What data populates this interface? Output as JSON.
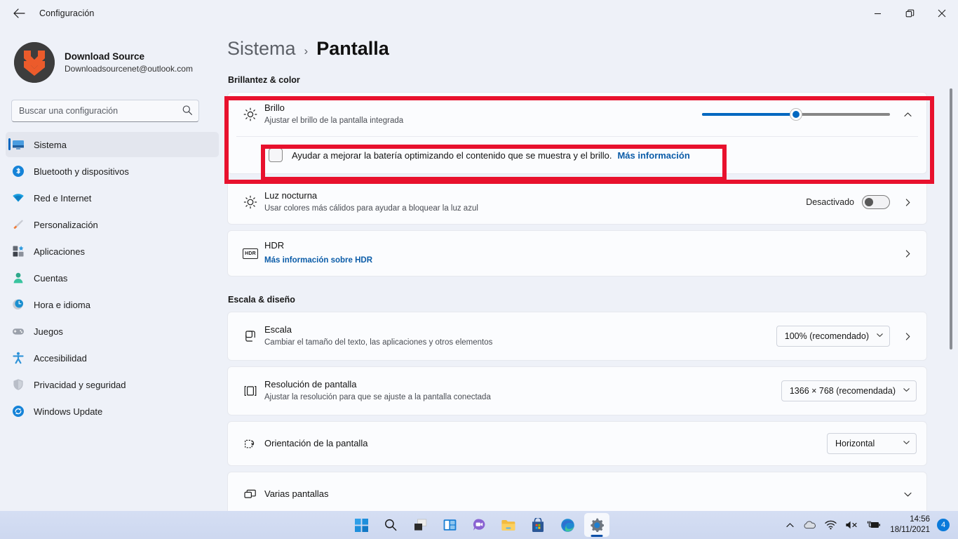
{
  "window": {
    "title": "Configuración",
    "back_icon": "arrow-left-icon",
    "minimize_label": "—",
    "maximize_label": "❐",
    "close_label": "✕"
  },
  "account": {
    "name": "Download Source",
    "email": "Downloadsourcenet@outlook.com",
    "avatar_icon": "double-chevron-down-avatar",
    "avatar_bg": "#3d3d3d",
    "avatar_fg": "#ec5b2b"
  },
  "search": {
    "placeholder": "Buscar una configuración",
    "value": "",
    "icon": "search-icon"
  },
  "sidebar": {
    "items": [
      {
        "label": "Sistema",
        "icon": "monitor-icon",
        "active": true
      },
      {
        "label": "Bluetooth y dispositivos",
        "icon": "bluetooth-icon",
        "active": false
      },
      {
        "label": "Red e Internet",
        "icon": "wifi-icon",
        "active": false
      },
      {
        "label": "Personalización",
        "icon": "paintbrush-icon",
        "active": false
      },
      {
        "label": "Aplicaciones",
        "icon": "apps-icon",
        "active": false
      },
      {
        "label": "Cuentas",
        "icon": "person-icon",
        "active": false
      },
      {
        "label": "Hora e idioma",
        "icon": "clock-globe-icon",
        "active": false
      },
      {
        "label": "Juegos",
        "icon": "gamepad-icon",
        "active": false
      },
      {
        "label": "Accesibilidad",
        "icon": "accessibility-icon",
        "active": false
      },
      {
        "label": "Privacidad y seguridad",
        "icon": "shield-icon",
        "active": false
      },
      {
        "label": "Windows Update",
        "icon": "update-icon",
        "active": false
      }
    ]
  },
  "breadcrumb": {
    "root": "Sistema",
    "separator": "›",
    "leaf": "Pantalla"
  },
  "sections": {
    "brightness_color": {
      "title": "Brillantez & color",
      "brightness": {
        "icon": "sun-icon",
        "title": "Brillo",
        "subtitle": "Ajustar el brillo de la pantalla integrada",
        "slider_value": 50,
        "slider_min": 0,
        "slider_max": 100,
        "expander_icon": "chevron-up-icon"
      },
      "battery_checkbox": {
        "checked": false,
        "label": "Ayudar a mejorar la batería optimizando el contenido que se muestra y el brillo.",
        "link": "Más información"
      },
      "night_light": {
        "icon": "night-light-icon",
        "title": "Luz nocturna",
        "subtitle": "Usar colores más cálidos para ayudar a bloquear la luz azul",
        "state_label": "Desactivado",
        "toggle_on": false,
        "chevron_icon": "chevron-right-icon"
      },
      "hdr": {
        "icon": "hdr-icon",
        "icon_text": "HDR",
        "title": "HDR",
        "link": "Más información sobre HDR",
        "chevron_icon": "chevron-right-icon"
      }
    },
    "scale_layout": {
      "title": "Escala & diseño",
      "scale": {
        "icon": "scale-icon",
        "title": "Escala",
        "subtitle": "Cambiar el tamaño del texto, las aplicaciones y otros elementos",
        "value": "100% (recomendado)",
        "dropdown_icon": "chevron-down-icon",
        "chevron_icon": "chevron-right-icon"
      },
      "resolution": {
        "icon": "resolution-icon",
        "title": "Resolución de pantalla",
        "subtitle": "Ajustar la resolución para que se ajuste a la pantalla conectada",
        "value": "1366 × 768 (recomendada)",
        "dropdown_icon": "chevron-down-icon"
      },
      "orientation": {
        "icon": "orientation-icon",
        "title": "Orientación de la pantalla",
        "value": "Horizontal",
        "dropdown_icon": "chevron-down-icon"
      },
      "multiple_displays": {
        "icon": "multiple-displays-icon",
        "title": "Varias pantallas",
        "expander_icon": "chevron-down-icon"
      }
    }
  },
  "annotations": {
    "color": "#e8112d",
    "boxes": [
      {
        "name": "brightness-card-highlight"
      },
      {
        "name": "battery-checkbox-highlight"
      }
    ]
  },
  "taskbar": {
    "items": [
      {
        "label": "Inicio",
        "icon": "windows-start-icon",
        "active": false
      },
      {
        "label": "Buscar",
        "icon": "search-icon",
        "active": false
      },
      {
        "label": "Vista de tareas",
        "icon": "task-view-icon",
        "active": false
      },
      {
        "label": "Widgets",
        "icon": "widgets-icon",
        "active": false
      },
      {
        "label": "Chat",
        "icon": "chat-icon",
        "active": false
      },
      {
        "label": "Explorador de archivos",
        "icon": "file-explorer-icon",
        "active": false
      },
      {
        "label": "Microsoft Store",
        "icon": "store-icon",
        "active": false
      },
      {
        "label": "Microsoft Edge",
        "icon": "edge-icon",
        "active": false
      },
      {
        "label": "Configuración",
        "icon": "settings-gear-icon",
        "active": true
      }
    ],
    "tray": {
      "overflow_icon": "chevron-up-icon",
      "onedrive_icon": "cloud-icon",
      "wifi_icon": "wifi-icon",
      "volume_icon": "speaker-muted-icon",
      "battery_icon": "battery-charging-icon",
      "time": "14:56",
      "date": "18/11/2021",
      "notification_count": "4"
    }
  }
}
